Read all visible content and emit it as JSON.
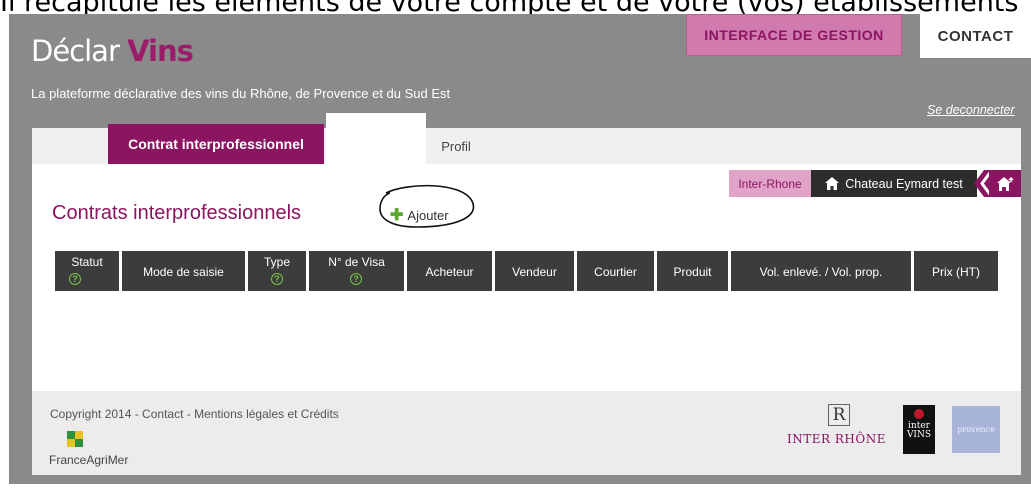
{
  "caption": "Il récapitule les éléments de votre compte et de votre (vos) établissements",
  "header": {
    "logo_part1": "Déclar",
    "logo_part2": "Vins",
    "tagline": "La plateforme déclarative des vins du Rhône, de Provence et du Sud Est",
    "gestion_label": "INTERFACE DE GESTION",
    "contact_label": "CONTACT",
    "logout_label": "Se deconnecter"
  },
  "tabs": {
    "contrat": "Contrat interprofessionnel",
    "profil": "Profil"
  },
  "breadcrumb": {
    "org": "Inter-Rhone",
    "establishment": "Chateau Eymard test"
  },
  "main": {
    "title": "Contrats interprofessionnels",
    "add_label": "Ajouter"
  },
  "table": {
    "columns": [
      {
        "label": "Statut",
        "help": "?"
      },
      {
        "label": "Mode de saisie"
      },
      {
        "label": "Type",
        "help": "?"
      },
      {
        "label": "N° de Visa",
        "help": "?"
      },
      {
        "label": "Acheteur"
      },
      {
        "label": "Vendeur"
      },
      {
        "label": "Courtier"
      },
      {
        "label": "Produit"
      },
      {
        "label": "Vol. enlevé. / Vol. prop."
      },
      {
        "label": "Prix (HT)"
      }
    ]
  },
  "footer": {
    "copyright": "Copyright 2014 - Contact - Mentions légales et Crédits",
    "franceagrimer": "FranceAgriMer",
    "interrhone_letter": "R",
    "interrhone": "INTER RHÔNE",
    "intervins_1": "inter",
    "intervins_2": "VINS",
    "provence": "provence"
  },
  "colors": {
    "brand": "#8b1560",
    "gestion_bg": "#d07aae",
    "header_bg": "#8a8a8a",
    "table_header": "#3c3c3c",
    "help_icon": "#7cc24a"
  },
  "icons": [
    "home-icon",
    "home-up-icon",
    "plus-icon",
    "help-icon",
    "back-arrow-icon"
  ]
}
